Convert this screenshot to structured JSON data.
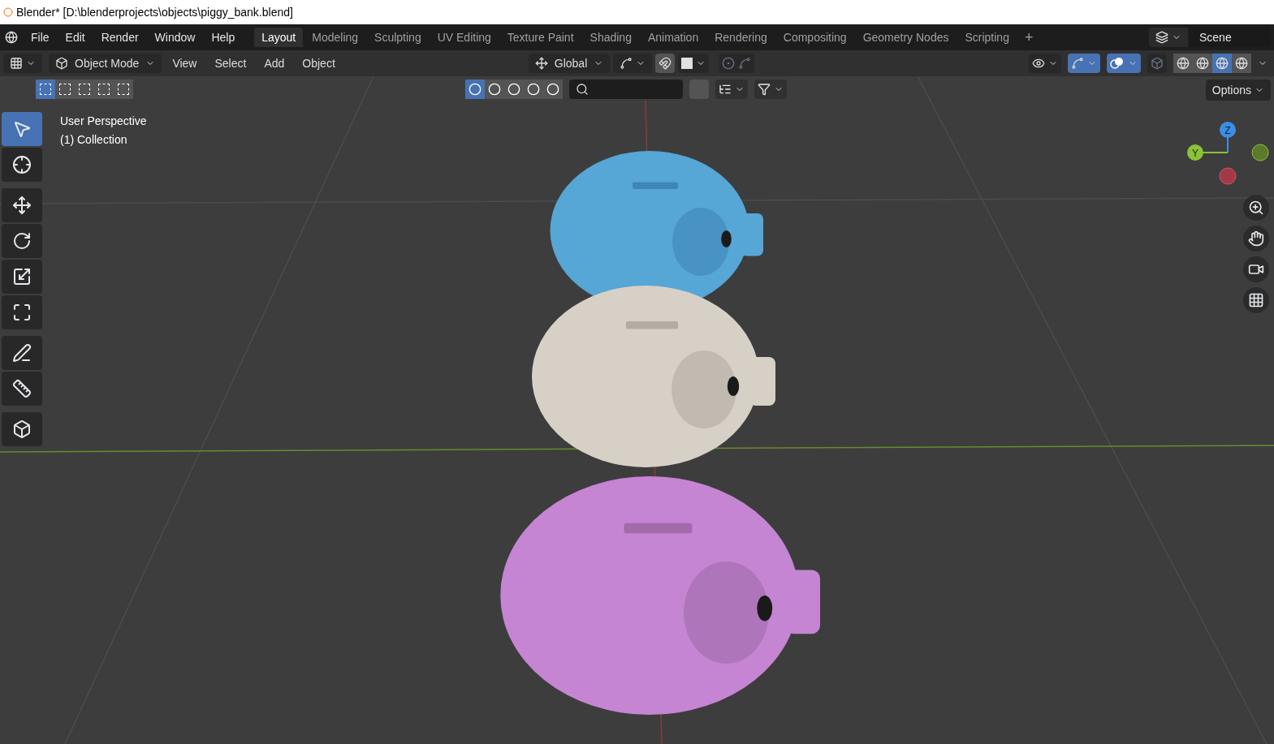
{
  "window": {
    "title": "Blender* [D:\\blenderprojects\\objects\\piggy_bank.blend]"
  },
  "menu": [
    "File",
    "Edit",
    "Render",
    "Window",
    "Help"
  ],
  "workspaces": [
    {
      "label": "Layout",
      "selected": true
    },
    {
      "label": "Modeling",
      "selected": false
    },
    {
      "label": "Sculpting",
      "selected": false
    },
    {
      "label": "UV Editing",
      "selected": false
    },
    {
      "label": "Texture Paint",
      "selected": false
    },
    {
      "label": "Shading",
      "selected": false
    },
    {
      "label": "Animation",
      "selected": false
    },
    {
      "label": "Rendering",
      "selected": false
    },
    {
      "label": "Compositing",
      "selected": false
    },
    {
      "label": "Geometry Nodes",
      "selected": false
    },
    {
      "label": "Scripting",
      "selected": false
    }
  ],
  "add_workspace": "+",
  "scene": "Scene",
  "header": {
    "mode": "Object Mode",
    "menus": [
      "View",
      "Select",
      "Add",
      "Object"
    ],
    "orientation": "Global",
    "snap_on": false,
    "proportional_on": false,
    "gizmos_on": true,
    "overlays_on": true
  },
  "select_modes": [
    {
      "selected": true
    },
    {
      "selected": false
    },
    {
      "selected": false
    },
    {
      "selected": false
    },
    {
      "selected": false
    }
  ],
  "filter_modes": [
    {
      "selected": true
    },
    {
      "selected": false
    },
    {
      "selected": false
    },
    {
      "selected": false
    },
    {
      "selected": false
    }
  ],
  "shading": [
    {
      "selected": false
    },
    {
      "selected": false
    },
    {
      "selected": true
    },
    {
      "selected": false
    }
  ],
  "options": "Options",
  "tools": [
    {
      "kind": "select",
      "selected": true
    },
    {
      "kind": "cursor",
      "selected": false
    },
    {
      "kind": "move",
      "selected": false
    },
    {
      "kind": "rotate",
      "selected": false
    },
    {
      "kind": "scale",
      "selected": false
    },
    {
      "kind": "transform",
      "selected": false
    },
    {
      "kind": "annotate",
      "selected": false
    },
    {
      "kind": "measure",
      "selected": false
    },
    {
      "kind": "add",
      "selected": false
    }
  ],
  "viewport": {
    "view": "User Perspective",
    "collection": "(1) Collection"
  },
  "gizmo": {
    "z": "Z",
    "y": "Y"
  }
}
